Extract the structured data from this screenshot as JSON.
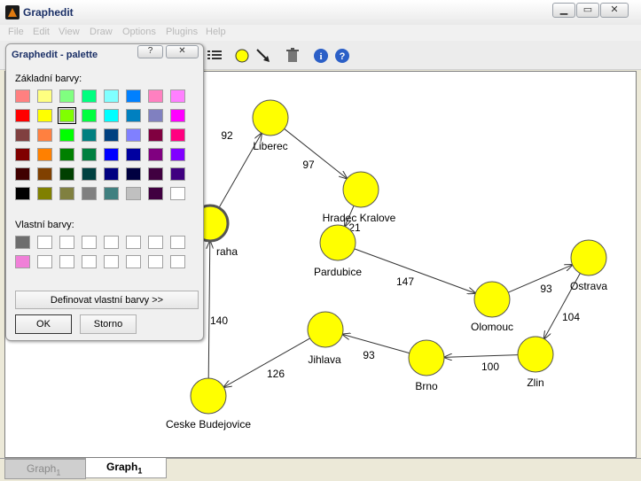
{
  "window": {
    "title": "Graphedit",
    "controls": [
      "minimize",
      "maximize",
      "close"
    ]
  },
  "menu": [
    "File",
    "Edit",
    "View",
    "Draw",
    "Options",
    "Plugins",
    "Help"
  ],
  "toolbar": {
    "icons": [
      "columns-icon",
      "node-tool-icon",
      "arrow-tool-icon",
      "trash-icon",
      "info-icon",
      "help-icon"
    ]
  },
  "palette": {
    "title": "Graphedit - palette",
    "help_label": "?",
    "close_label": "✕",
    "basic_label": "Základní barvy:",
    "custom_label": "Vlastní barvy:",
    "basic_colors": [
      [
        "#ff8080",
        "#ffff80",
        "#80ff80",
        "#00ff80",
        "#80ffff",
        "#0080ff",
        "#ff80c0",
        "#ff80ff"
      ],
      [
        "#ff0000",
        "#ffff00",
        "#80ff00",
        "#00ff40",
        "#00ffff",
        "#0080c0",
        "#8080c0",
        "#ff00ff"
      ],
      [
        "#804040",
        "#ff8040",
        "#00ff00",
        "#008080",
        "#004080",
        "#8080ff",
        "#800040",
        "#ff0080"
      ],
      [
        "#800000",
        "#ff8000",
        "#008000",
        "#008040",
        "#0000ff",
        "#0000a0",
        "#800080",
        "#8000ff"
      ],
      [
        "#400000",
        "#804000",
        "#004000",
        "#004040",
        "#000080",
        "#000040",
        "#400040",
        "#400080"
      ],
      [
        "#000000",
        "#808000",
        "#808040",
        "#808080",
        "#408080",
        "#c0c0c0",
        "#400040",
        "#ffffff"
      ]
    ],
    "selected_basic": [
      1,
      2
    ],
    "custom_colors": [
      [
        "#6e6e6e",
        "#ffffff",
        "#ffffff",
        "#ffffff",
        "#ffffff",
        "#ffffff",
        "#ffffff",
        "#ffffff"
      ],
      [
        "#f080d8",
        "#ffffff",
        "#ffffff",
        "#ffffff",
        "#ffffff",
        "#ffffff",
        "#ffffff",
        "#ffffff"
      ]
    ],
    "define_label": "Definovat vlastní barvy >>",
    "ok_label": "OK",
    "cancel_label": "Storno"
  },
  "graph": {
    "node_color": "#ffff00",
    "nodes": [
      {
        "id": "praha",
        "label": "Praha",
        "label_visible": "raha"
      },
      {
        "id": "liberec",
        "label": "Liberec"
      },
      {
        "id": "hradec",
        "label": "Hradec Kralove"
      },
      {
        "id": "pardubice",
        "label": "Pardubice"
      },
      {
        "id": "olomouc",
        "label": "Olomouc"
      },
      {
        "id": "ostrava",
        "label": "Ostrava"
      },
      {
        "id": "zlin",
        "label": "Zlin"
      },
      {
        "id": "brno",
        "label": "Brno"
      },
      {
        "id": "jihlava",
        "label": "Jihlava"
      },
      {
        "id": "cb",
        "label": "Ceske Budejovice"
      }
    ],
    "edges": [
      {
        "from": "praha",
        "to": "liberec",
        "weight": "92"
      },
      {
        "from": "liberec",
        "to": "hradec",
        "weight": "97"
      },
      {
        "from": "hradec",
        "to": "pardubice",
        "weight": "21"
      },
      {
        "from": "pardubice",
        "to": "olomouc",
        "weight": "147"
      },
      {
        "from": "olomouc",
        "to": "ostrava",
        "weight": "93"
      },
      {
        "from": "ostrava",
        "to": "zlin",
        "weight": "104"
      },
      {
        "from": "zlin",
        "to": "brno",
        "weight": "100"
      },
      {
        "from": "brno",
        "to": "jihlava",
        "weight": "93"
      },
      {
        "from": "jihlava",
        "to": "cb",
        "weight": "126"
      },
      {
        "from": "cb",
        "to": "praha",
        "weight": "140"
      }
    ]
  },
  "tabs": [
    {
      "label": "Graph",
      "sub": "1",
      "active": false
    },
    {
      "label": "Graph",
      "sub": "1",
      "active": true
    }
  ]
}
